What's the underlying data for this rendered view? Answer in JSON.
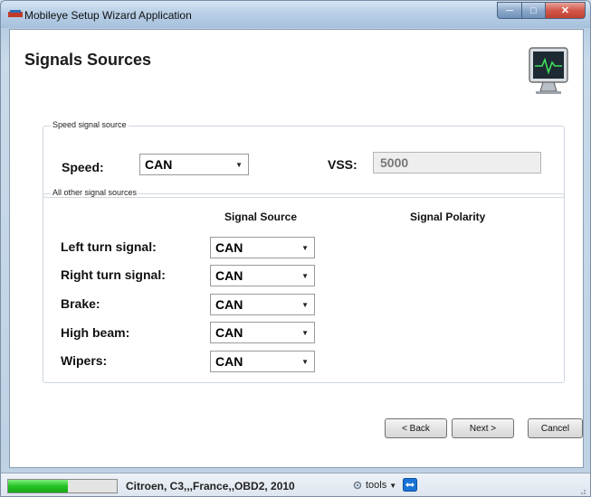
{
  "window": {
    "title": "Mobileye Setup Wizard Application"
  },
  "page": {
    "title": "Signals Sources"
  },
  "speed_group": {
    "label": "Speed signal source",
    "speed_label": "Speed:",
    "speed_value": "CAN",
    "vss_label": "VSS:",
    "vss_value": "5000"
  },
  "signals_group": {
    "label": "All other signal sources",
    "col_source": "Signal Source",
    "col_polarity": "Signal Polarity",
    "rows": [
      {
        "label": "Left turn signal:",
        "source": "CAN"
      },
      {
        "label": "Right turn signal:",
        "source": "CAN"
      },
      {
        "label": "Brake:",
        "source": "CAN"
      },
      {
        "label": "High beam:",
        "source": "CAN"
      },
      {
        "label": "Wipers:",
        "source": "CAN"
      }
    ]
  },
  "buttons": {
    "back": "< Back",
    "next": "Next >",
    "cancel": "Cancel"
  },
  "status": {
    "progress_percent": 55,
    "vehicle": "Citroen, C3,,,France,,OBD2, 2010",
    "tools_label": "tools"
  },
  "colors": {
    "progress_green": "#25c425",
    "close_red": "#c0402f",
    "title_blue": "#a7c1dc"
  },
  "icons": {
    "app": "app-icon",
    "monitor": "monitor-heartbeat-icon",
    "tools": "tools-icon",
    "teamviewer": "teamviewer-icon"
  }
}
